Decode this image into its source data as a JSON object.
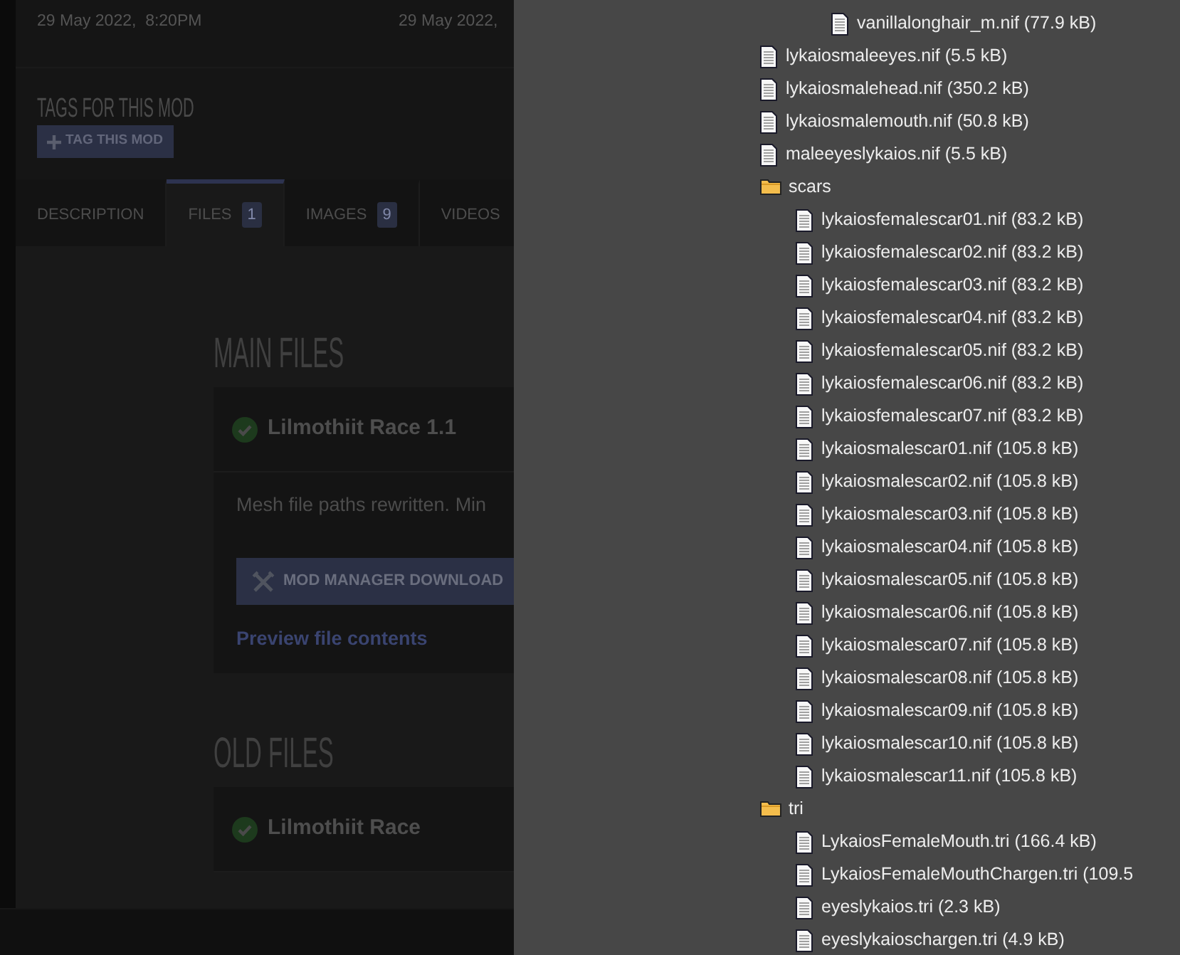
{
  "page": {
    "dates": [
      "29 May 2022,  8:20PM",
      "29 May 2022,"
    ],
    "tags_heading": "TAGS FOR THIS MOD",
    "tag_button": "TAG THIS MOD",
    "tabs": [
      {
        "label": "DESCRIPTION",
        "selected": false
      },
      {
        "label": "FILES",
        "count": "1",
        "selected": true
      },
      {
        "label": "IMAGES",
        "count": "9",
        "selected": false
      },
      {
        "label": "VIDEOS",
        "selected": false
      }
    ],
    "sections": [
      {
        "heading": "MAIN FILES",
        "files": [
          {
            "title": "Lilmothiit Race 1.1",
            "description": "Mesh file paths rewritten. Min",
            "download_button": "MOD MANAGER DOWNLOAD",
            "preview_link": "Preview file contents"
          }
        ]
      },
      {
        "heading": "OLD FILES",
        "files": [
          {
            "title": "Lilmothiit Race"
          }
        ]
      }
    ]
  },
  "file_tree": {
    "items": [
      {
        "kind": "folder",
        "children": [
          {
            "kind": "folder",
            "children": [
              {
                "kind": "file",
                "label": "vanillalonghair_m.nif (77.9 kB)"
              }
            ]
          }
        ]
      },
      {
        "kind": "file",
        "label": "lykaiosmaleeyes.nif (5.5 kB)"
      },
      {
        "kind": "file",
        "label": "lykaiosmalehead.nif (350.2 kB)"
      },
      {
        "kind": "file",
        "label": "lykaiosmalemouth.nif (50.8 kB)"
      },
      {
        "kind": "file",
        "label": "maleeyeslykaios.nif (5.5 kB)"
      },
      {
        "kind": "folder",
        "label": "scars",
        "children": [
          {
            "kind": "file",
            "label": "lykaiosfemalescar01.nif (83.2 kB)"
          },
          {
            "kind": "file",
            "label": "lykaiosfemalescar02.nif (83.2 kB)"
          },
          {
            "kind": "file",
            "label": "lykaiosfemalescar03.nif (83.2 kB)"
          },
          {
            "kind": "file",
            "label": "lykaiosfemalescar04.nif (83.2 kB)"
          },
          {
            "kind": "file",
            "label": "lykaiosfemalescar05.nif (83.2 kB)"
          },
          {
            "kind": "file",
            "label": "lykaiosfemalescar06.nif (83.2 kB)"
          },
          {
            "kind": "file",
            "label": "lykaiosfemalescar07.nif (83.2 kB)"
          },
          {
            "kind": "file",
            "label": "lykaiosmalescar01.nif (105.8 kB)"
          },
          {
            "kind": "file",
            "label": "lykaiosmalescar02.nif (105.8 kB)"
          },
          {
            "kind": "file",
            "label": "lykaiosmalescar03.nif (105.8 kB)"
          },
          {
            "kind": "file",
            "label": "lykaiosmalescar04.nif (105.8 kB)"
          },
          {
            "kind": "file",
            "label": "lykaiosmalescar05.nif (105.8 kB)"
          },
          {
            "kind": "file",
            "label": "lykaiosmalescar06.nif (105.8 kB)"
          },
          {
            "kind": "file",
            "label": "lykaiosmalescar07.nif (105.8 kB)"
          },
          {
            "kind": "file",
            "label": "lykaiosmalescar08.nif (105.8 kB)"
          },
          {
            "kind": "file",
            "label": "lykaiosmalescar09.nif (105.8 kB)"
          },
          {
            "kind": "file",
            "label": "lykaiosmalescar10.nif (105.8 kB)"
          },
          {
            "kind": "file",
            "label": "lykaiosmalescar11.nif (105.8 kB)"
          }
        ]
      },
      {
        "kind": "folder",
        "label": "tri",
        "children": [
          {
            "kind": "file",
            "label": "LykaiosFemaleMouth.tri (166.4 kB)"
          },
          {
            "kind": "file",
            "label": "LykaiosFemaleMouthChargen.tri (109.5"
          },
          {
            "kind": "file",
            "label": "eyeslykaios.tri (2.3 kB)"
          },
          {
            "kind": "file",
            "label": "eyeslykaioschargen.tri (4.9 kB)"
          }
        ]
      }
    ]
  }
}
